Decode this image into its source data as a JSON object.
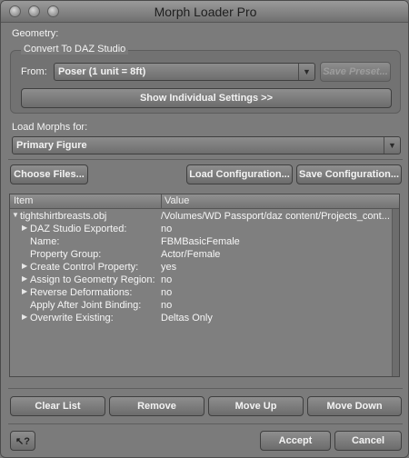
{
  "window": {
    "title": "Morph Loader Pro"
  },
  "geometry": {
    "label": "Geometry:",
    "convert_group_label": "Convert To DAZ Studio",
    "from_label": "From:",
    "from_value": "Poser (1 unit = 8ft)",
    "save_preset_label": "Save Preset...",
    "show_settings_label": "Show Individual Settings >>"
  },
  "load_morphs": {
    "label": "Load Morphs for:",
    "value": "Primary Figure"
  },
  "file_buttons": {
    "choose_files": "Choose Files...",
    "load_configuration": "Load Configuration...",
    "save_configuration": "Save Configuration..."
  },
  "tree": {
    "columns": [
      "Item",
      "Value"
    ],
    "rows": [
      {
        "expander": "▼",
        "indent": 0,
        "item": "tightshirtbreasts.obj",
        "value": "/Volumes/WD Passport/daz content/Projects_cont..."
      },
      {
        "expander": "▶",
        "indent": 1,
        "item": "DAZ Studio Exported:",
        "value": "no"
      },
      {
        "expander": "",
        "indent": 1,
        "item": "Name:",
        "value": "FBMBasicFemale"
      },
      {
        "expander": "",
        "indent": 1,
        "item": "Property Group:",
        "value": "Actor/Female"
      },
      {
        "expander": "▶",
        "indent": 1,
        "item": "Create Control Property:",
        "value": "yes"
      },
      {
        "expander": "▶",
        "indent": 1,
        "item": "Assign to Geometry Region:",
        "value": "no"
      },
      {
        "expander": "▶",
        "indent": 1,
        "item": "Reverse Deformations:",
        "value": "no"
      },
      {
        "expander": "",
        "indent": 1,
        "item": "Apply After Joint Binding:",
        "value": "no"
      },
      {
        "expander": "▶",
        "indent": 1,
        "item": "Overwrite Existing:",
        "value": "Deltas Only"
      }
    ]
  },
  "list_buttons": {
    "clear_list": "Clear List",
    "remove": "Remove",
    "move_up": "Move Up",
    "move_down": "Move Down"
  },
  "footer": {
    "help_icon": "help-question-icon",
    "accept": "Accept",
    "cancel": "Cancel"
  }
}
